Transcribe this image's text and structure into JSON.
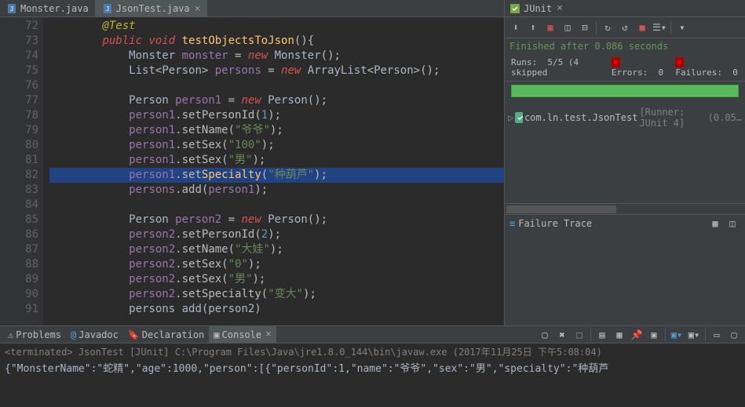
{
  "editor": {
    "tabs": [
      {
        "label": "Monster.java",
        "active": false
      },
      {
        "label": "JsonTest.java",
        "active": true
      }
    ],
    "lines": [
      {
        "num": "72",
        "ann": "⊖",
        "tokens": [
          {
            "t": "        "
          },
          {
            "t": "@Test",
            "c": "ann-keyword"
          }
        ]
      },
      {
        "num": "73",
        "tokens": [
          {
            "t": "        "
          },
          {
            "t": "public ",
            "c": "kw-red"
          },
          {
            "t": "void ",
            "c": "kw-red"
          },
          {
            "t": "testObjectsToJson",
            "c": "ident"
          },
          {
            "t": "(){"
          }
        ]
      },
      {
        "num": "74",
        "tokens": [
          {
            "t": "            "
          },
          {
            "t": "Monster ",
            "c": "type"
          },
          {
            "t": "monster",
            "c": "var"
          },
          {
            "t": " = "
          },
          {
            "t": "new ",
            "c": "kw-red"
          },
          {
            "t": "Monster",
            "c": "type"
          },
          {
            "t": "();"
          }
        ]
      },
      {
        "num": "75",
        "tokens": [
          {
            "t": "            "
          },
          {
            "t": "List",
            "c": "type"
          },
          {
            "t": "<"
          },
          {
            "t": "Person",
            "c": "type"
          },
          {
            "t": "> "
          },
          {
            "t": "persons",
            "c": "var"
          },
          {
            "t": " = "
          },
          {
            "t": "new ",
            "c": "kw-red"
          },
          {
            "t": "ArrayList",
            "c": "type"
          },
          {
            "t": "<"
          },
          {
            "t": "Person",
            "c": "type"
          },
          {
            "t": ">();"
          }
        ]
      },
      {
        "num": "76",
        "tokens": [
          {
            "t": ""
          }
        ]
      },
      {
        "num": "77",
        "tokens": [
          {
            "t": "            "
          },
          {
            "t": "Person ",
            "c": "type"
          },
          {
            "t": "person1",
            "c": "var"
          },
          {
            "t": " = "
          },
          {
            "t": "new ",
            "c": "kw-red"
          },
          {
            "t": "Person",
            "c": "type"
          },
          {
            "t": "();"
          }
        ]
      },
      {
        "num": "78",
        "tokens": [
          {
            "t": "            "
          },
          {
            "t": "person1",
            "c": "var"
          },
          {
            "t": ".setPersonId("
          },
          {
            "t": "1",
            "c": "num"
          },
          {
            "t": ");"
          }
        ]
      },
      {
        "num": "79",
        "tokens": [
          {
            "t": "            "
          },
          {
            "t": "person1",
            "c": "var"
          },
          {
            "t": ".setName("
          },
          {
            "t": "\"爷爷\"",
            "c": "str"
          },
          {
            "t": ");"
          }
        ]
      },
      {
        "num": "80",
        "tokens": [
          {
            "t": "            "
          },
          {
            "t": "person1",
            "c": "var"
          },
          {
            "t": ".setSex("
          },
          {
            "t": "\"100\"",
            "c": "str"
          },
          {
            "t": ");"
          }
        ]
      },
      {
        "num": "81",
        "tokens": [
          {
            "t": "            "
          },
          {
            "t": "person1",
            "c": "var"
          },
          {
            "t": ".setSex("
          },
          {
            "t": "\"男\"",
            "c": "str"
          },
          {
            "t": ");"
          }
        ]
      },
      {
        "num": "82",
        "hl": true,
        "tokens": [
          {
            "t": "            "
          },
          {
            "t": "person1",
            "c": "var"
          },
          {
            "t": ".set"
          },
          {
            "t": "Specialty",
            "c": "ident"
          },
          {
            "t": "("
          },
          {
            "t": "\"种葫芦\"",
            "c": "str"
          },
          {
            "t": ");"
          }
        ]
      },
      {
        "num": "83",
        "tokens": [
          {
            "t": "            "
          },
          {
            "t": "persons",
            "c": "var"
          },
          {
            "t": ".add("
          },
          {
            "t": "person1",
            "c": "var"
          },
          {
            "t": ");"
          }
        ]
      },
      {
        "num": "84",
        "tokens": [
          {
            "t": ""
          }
        ]
      },
      {
        "num": "85",
        "tokens": [
          {
            "t": "            "
          },
          {
            "t": "Person ",
            "c": "type"
          },
          {
            "t": "person2",
            "c": "var"
          },
          {
            "t": " = "
          },
          {
            "t": "new ",
            "c": "kw-red"
          },
          {
            "t": "Person",
            "c": "type"
          },
          {
            "t": "();"
          }
        ]
      },
      {
        "num": "86",
        "tokens": [
          {
            "t": "            "
          },
          {
            "t": "person2",
            "c": "var"
          },
          {
            "t": ".setPersonId("
          },
          {
            "t": "2",
            "c": "num"
          },
          {
            "t": ");"
          }
        ]
      },
      {
        "num": "87",
        "tokens": [
          {
            "t": "            "
          },
          {
            "t": "person2",
            "c": "var"
          },
          {
            "t": ".setName("
          },
          {
            "t": "\"大娃\"",
            "c": "str"
          },
          {
            "t": ");"
          }
        ]
      },
      {
        "num": "88",
        "tokens": [
          {
            "t": "            "
          },
          {
            "t": "person2",
            "c": "var"
          },
          {
            "t": ".setSex("
          },
          {
            "t": "\"0\"",
            "c": "str"
          },
          {
            "t": ");"
          }
        ]
      },
      {
        "num": "89",
        "tokens": [
          {
            "t": "            "
          },
          {
            "t": "person2",
            "c": "var"
          },
          {
            "t": ".setSex("
          },
          {
            "t": "\"男\"",
            "c": "str"
          },
          {
            "t": ");"
          }
        ]
      },
      {
        "num": "90",
        "tokens": [
          {
            "t": "            "
          },
          {
            "t": "person2",
            "c": "var"
          },
          {
            "t": ".setSpecialty("
          },
          {
            "t": "\"变大\"",
            "c": "str"
          },
          {
            "t": ");"
          }
        ]
      },
      {
        "num": "91",
        "tokens": [
          {
            "t": "            "
          },
          {
            "t": "persons add(person2)",
            "c": "method"
          }
        ]
      }
    ]
  },
  "junit": {
    "title": "JUnit",
    "status": "Finished after 0.086 seconds",
    "runs_label": "Runs:",
    "runs_value": "5/5 (4 skipped",
    "errors_label": "Errors:",
    "errors_value": "0",
    "failures_label": "Failures:",
    "failures_value": "0",
    "tree_item": "com.ln.test.JsonTest",
    "tree_runner": "[Runner: JUnit 4]",
    "tree_time": "(0.05…",
    "failure_trace": "Failure Trace"
  },
  "bottom": {
    "tabs": [
      {
        "label": "Problems",
        "icon": "problems"
      },
      {
        "label": "Javadoc",
        "icon": "javadoc"
      },
      {
        "label": "Declaration",
        "icon": "declaration"
      },
      {
        "label": "Console",
        "icon": "console",
        "active": true
      }
    ],
    "terminated": "<terminated> JsonTest [JUnit] C:\\Program Files\\Java\\jre1.8.0_144\\bin\\javaw.exe (2017年11月25日 下午5:08:04)",
    "output": "{\"MonsterName\":\"蛇精\",\"age\":1000,\"person\":[{\"personId\":1,\"name\":\"爷爷\",\"sex\":\"男\",\"specialty\":\"种葫芦"
  }
}
